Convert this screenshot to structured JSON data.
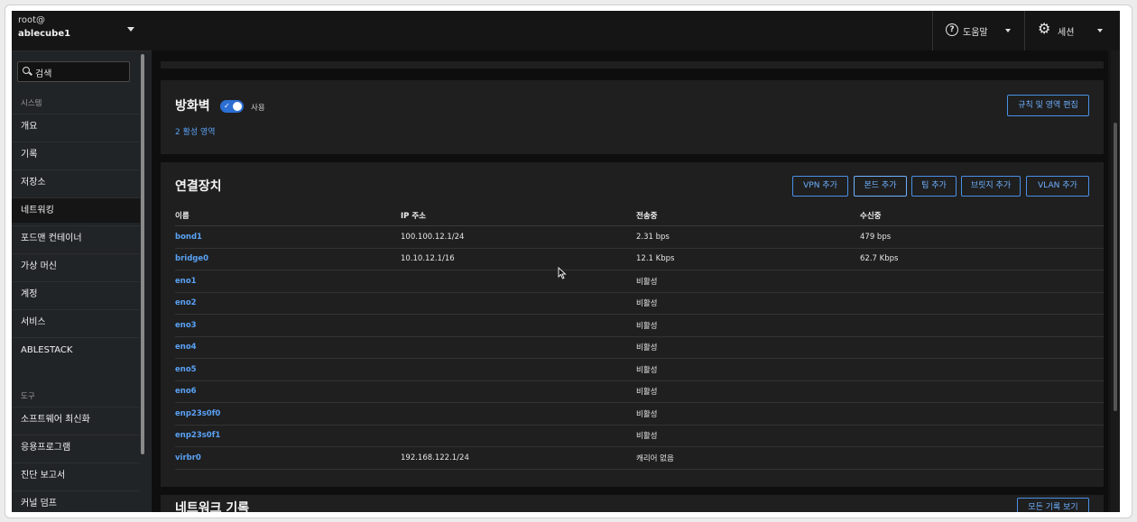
{
  "host": {
    "user": "root@",
    "name": "ablecube1"
  },
  "search": {
    "label": "검색"
  },
  "sidebar": {
    "system_title": "시스템",
    "items": [
      {
        "label": "개요"
      },
      {
        "label": "기록"
      },
      {
        "label": "저장소"
      },
      {
        "label": "네트워킹"
      },
      {
        "label": "포드맨 컨테이너"
      },
      {
        "label": "가상 머신"
      },
      {
        "label": "계정"
      },
      {
        "label": "서비스"
      },
      {
        "label": "ABLESTACK"
      }
    ],
    "tools_title": "도구",
    "tools": [
      {
        "label": "소프트웨어 최신화"
      },
      {
        "label": "응용프로그램"
      },
      {
        "label": "진단 보고서"
      },
      {
        "label": "커널 덤프"
      }
    ]
  },
  "topbar": {
    "help_label": "도움말",
    "session_label": "세션"
  },
  "firewall": {
    "title": "방화벽",
    "toggle_label": "사용",
    "zones_link": "2 활성 영역",
    "edit_button": "규칙 및 영역 편집"
  },
  "interfaces": {
    "title": "연결장치",
    "buttons": {
      "vpn": "VPN 추가",
      "bond": "본드 추가",
      "team": "팀 추가",
      "bridge": "브릿지 추가",
      "vlan": "VLAN 추가"
    },
    "columns": [
      "이름",
      "IP 주소",
      "전송중",
      "수신중"
    ],
    "rows": [
      {
        "name": "bond1",
        "ip": "100.100.12.1/24",
        "tx": "2.31 bps",
        "rx": "479 bps"
      },
      {
        "name": "bridge0",
        "ip": "10.10.12.1/16",
        "tx": "12.1 Kbps",
        "rx": "62.7 Kbps"
      },
      {
        "name": "eno1",
        "ip": "",
        "tx": "비활성",
        "rx": ""
      },
      {
        "name": "eno2",
        "ip": "",
        "tx": "비활성",
        "rx": ""
      },
      {
        "name": "eno3",
        "ip": "",
        "tx": "비활성",
        "rx": ""
      },
      {
        "name": "eno4",
        "ip": "",
        "tx": "비활성",
        "rx": ""
      },
      {
        "name": "eno5",
        "ip": "",
        "tx": "비활성",
        "rx": ""
      },
      {
        "name": "eno6",
        "ip": "",
        "tx": "비활성",
        "rx": ""
      },
      {
        "name": "enp23s0f0",
        "ip": "",
        "tx": "비활성",
        "rx": ""
      },
      {
        "name": "enp23s0f1",
        "ip": "",
        "tx": "비활성",
        "rx": ""
      },
      {
        "name": "virbr0",
        "ip": "192.168.122.1/24",
        "tx": "캐리어 없음",
        "rx": ""
      }
    ]
  },
  "netlog": {
    "title": "네트워크 기록",
    "button": "모든 기록 보기"
  },
  "colors": {
    "accent": "#5aa2f5",
    "toggle": "#2b6fd3",
    "background": "#151515",
    "card": "#1f1f1f"
  }
}
